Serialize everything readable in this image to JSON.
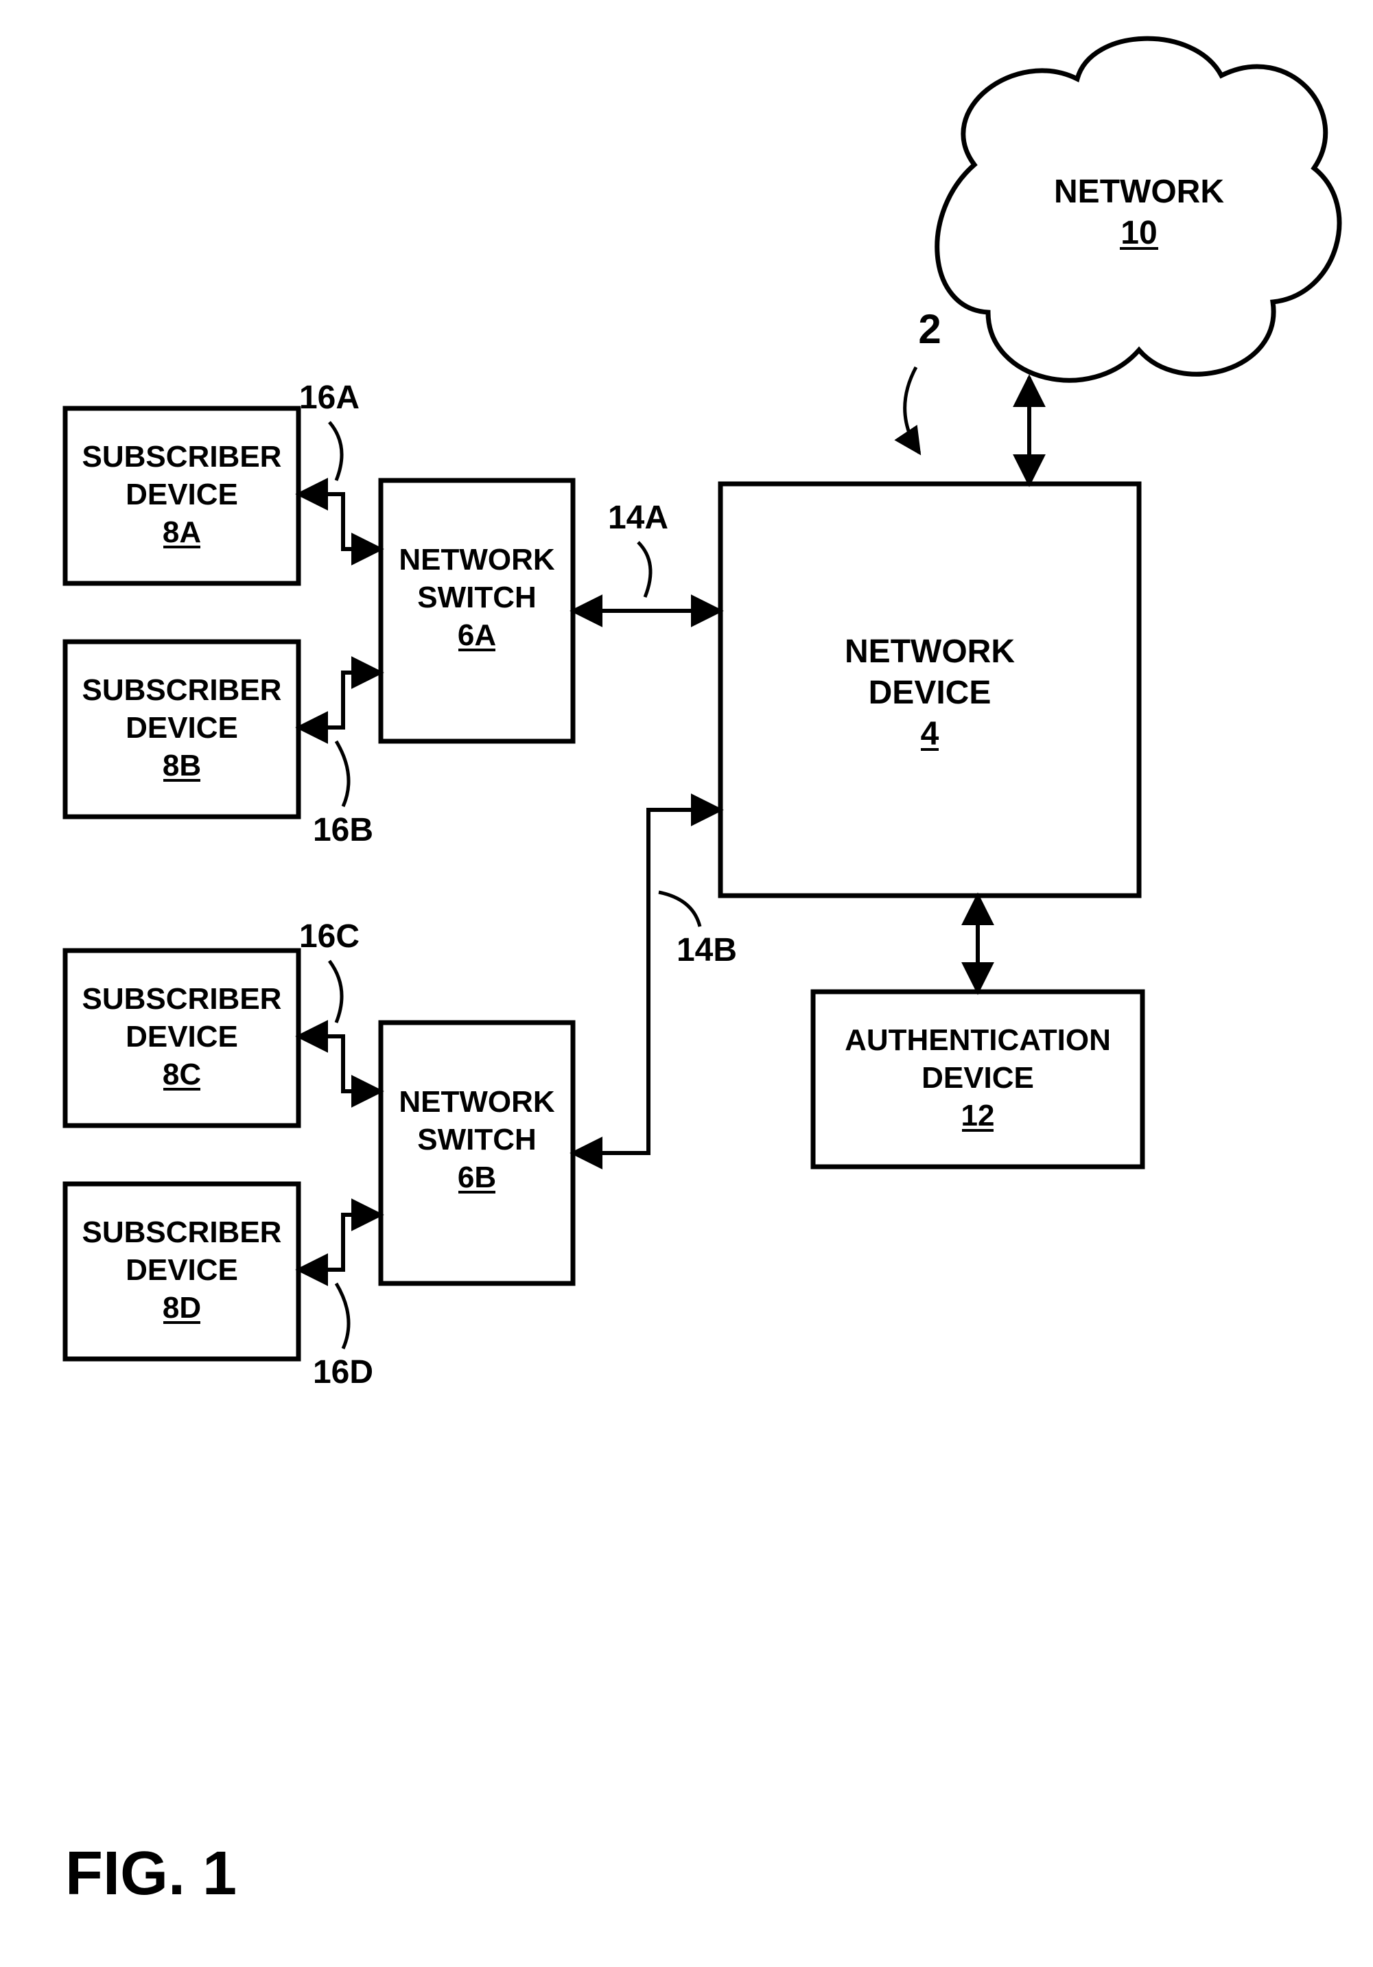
{
  "figure_label": "FIG. 1",
  "diagram_number": "2",
  "nodes": {
    "network": {
      "title": "NETWORK",
      "id": "10"
    },
    "network_device": {
      "title_line1": "NETWORK",
      "title_line2": "DEVICE",
      "id": "4"
    },
    "auth_device": {
      "title_line1": "AUTHENTICATION",
      "title_line2": "DEVICE",
      "id": "12"
    },
    "switch_a": {
      "title_line1": "NETWORK",
      "title_line2": "SWITCH",
      "id": "6A"
    },
    "switch_b": {
      "title_line1": "NETWORK",
      "title_line2": "SWITCH",
      "id": "6B"
    },
    "sub_a": {
      "title_line1": "SUBSCRIBER",
      "title_line2": "DEVICE",
      "id": "8A"
    },
    "sub_b": {
      "title_line1": "SUBSCRIBER",
      "title_line2": "DEVICE",
      "id": "8B"
    },
    "sub_c": {
      "title_line1": "SUBSCRIBER",
      "title_line2": "DEVICE",
      "id": "8C"
    },
    "sub_d": {
      "title_line1": "SUBSCRIBER",
      "title_line2": "DEVICE",
      "id": "8D"
    }
  },
  "link_labels": {
    "l14a": "14A",
    "l14b": "14B",
    "l16a": "16A",
    "l16b": "16B",
    "l16c": "16C",
    "l16d": "16D"
  }
}
